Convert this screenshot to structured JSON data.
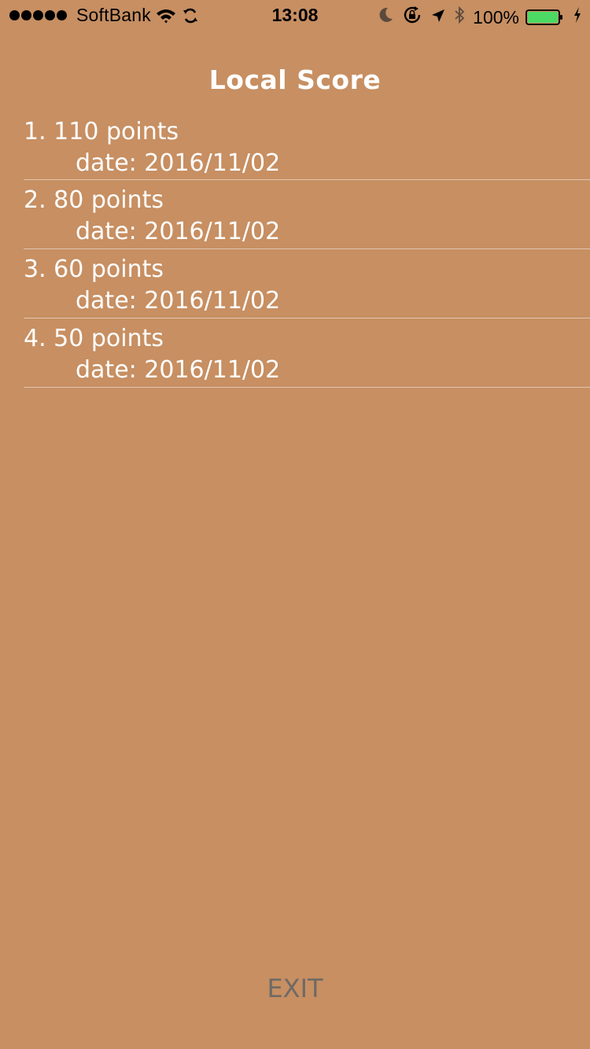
{
  "status_bar": {
    "carrier": "SoftBank",
    "time": "13:08",
    "battery_percent": "100%",
    "battery_level": 1.0,
    "battery_color": "#4cd964",
    "icons": [
      "signal-dots-icon",
      "wifi-icon",
      "sync-icon",
      "moon-icon",
      "rotation-lock-icon",
      "location-arrow-icon",
      "bluetooth-icon",
      "battery-icon",
      "charging-bolt-icon"
    ]
  },
  "page": {
    "title": "Local Score",
    "background_color": "#c78f62"
  },
  "scores": [
    {
      "rank_points": "1. 110 points",
      "date": "date: 2016/11/02"
    },
    {
      "rank_points": "2. 80 points",
      "date": "date: 2016/11/02"
    },
    {
      "rank_points": "3. 60 points",
      "date": "date: 2016/11/02"
    },
    {
      "rank_points": "4. 50 points",
      "date": "date: 2016/11/02"
    }
  ],
  "footer": {
    "exit_label": "EXIT",
    "exit_color": "#6e6a66"
  }
}
